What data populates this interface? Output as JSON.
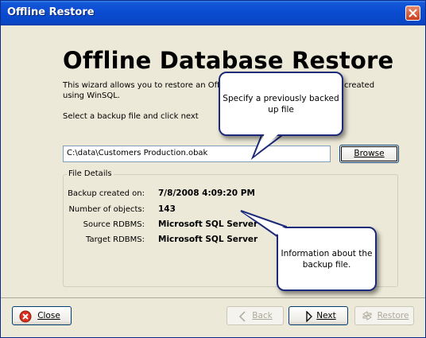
{
  "window": {
    "title": "Offline Restore"
  },
  "header": {
    "title": "Offline Database Restore"
  },
  "intro": {
    "text": "This wizard allows you to restore an Offline Database backup that you created using WinSQL."
  },
  "instruction": "Select a backup file and click next",
  "backup_file": {
    "value": "C:\\data\\Customers Production.obak",
    "browse_label": "Browse"
  },
  "file_details": {
    "group_label": "File Details",
    "rows": [
      {
        "label": "Backup created on:",
        "value": "7/8/2008 4:09:20 PM"
      },
      {
        "label": "Number of objects:",
        "value": "143"
      },
      {
        "label": "Source RDBMS:",
        "value": "Microsoft SQL Server"
      },
      {
        "label": "Target RDBMS:",
        "value": "Microsoft SQL Server"
      }
    ]
  },
  "footer": {
    "close_label": "Close",
    "back_label": "Back",
    "next_label": "Next",
    "restore_label": "Restore"
  },
  "callouts": {
    "top": "Specify a previously backed up file",
    "bottom": "Information about the backup file."
  },
  "colors": {
    "titlebar": "#0a4bd0",
    "callout_border": "#1c2a7a",
    "background": "#ece9d8"
  }
}
